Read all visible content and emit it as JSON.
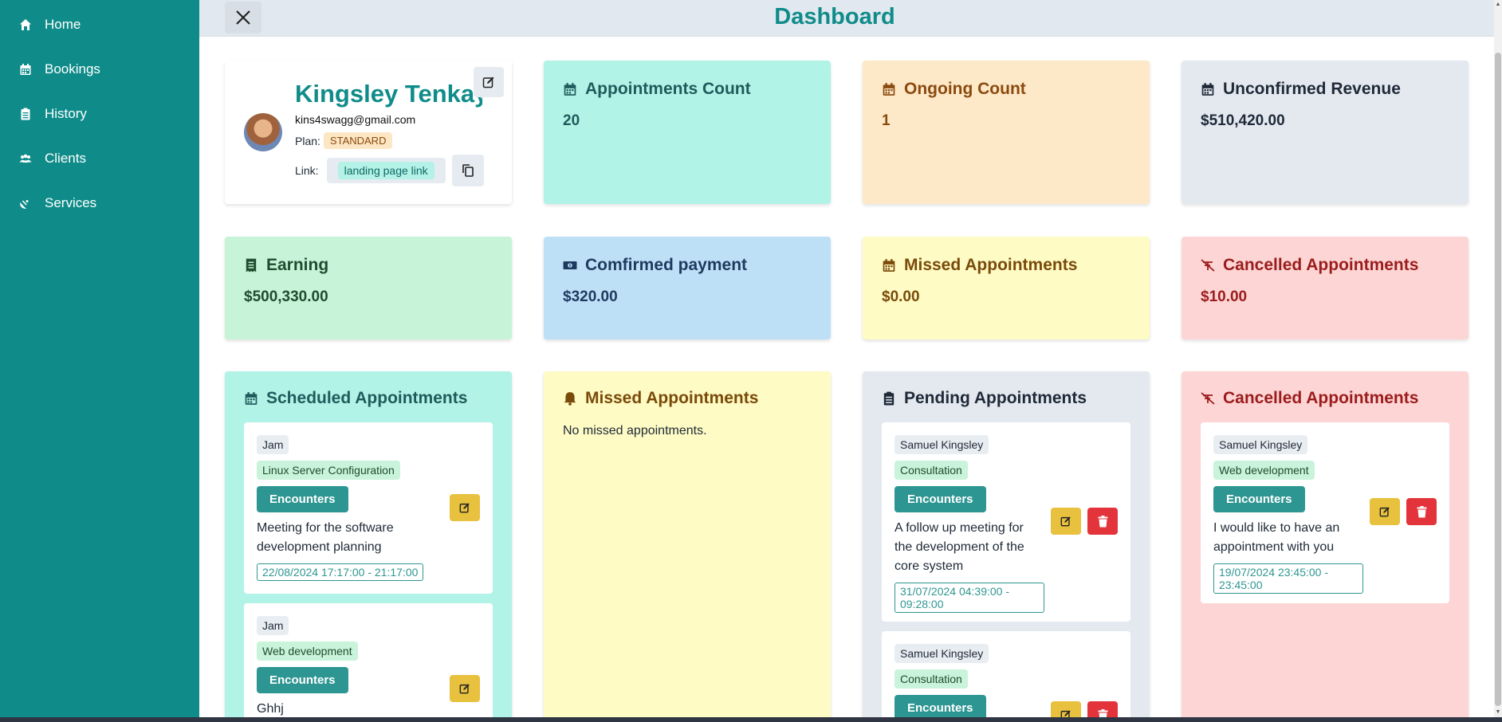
{
  "sidebar": {
    "items": [
      {
        "label": "Home",
        "icon": "home-icon"
      },
      {
        "label": "Bookings",
        "icon": "calendar-icon"
      },
      {
        "label": "History",
        "icon": "clipboard-icon"
      },
      {
        "label": "Clients",
        "icon": "users-icon"
      },
      {
        "label": "Services",
        "icon": "satellite-dish-icon"
      }
    ]
  },
  "header": {
    "title": "Dashboard"
  },
  "profile": {
    "name": "Kingsley Tenkay",
    "email": "kins4swagg@gmail.com",
    "plan_label": "Plan:",
    "plan": "STANDARD",
    "link_label": "Link:",
    "link_text": "landing page link"
  },
  "stats": {
    "appointments_count": {
      "title": "Appointments Count",
      "value": "20"
    },
    "ongoing_count": {
      "title": "Ongoing Count",
      "value": "1"
    },
    "unconfirmed_revenue": {
      "title": "Unconfirmed Revenue",
      "value": "$510,420.00"
    },
    "earning": {
      "title": "Earning",
      "value": "$500,330.00"
    },
    "confirmed_payment": {
      "title": "Comfirmed payment",
      "value": "$320.00"
    },
    "missed_appointments": {
      "title": "Missed Appointments",
      "value": "$0.00"
    },
    "cancelled_appointments": {
      "title": "Cancelled Appointments",
      "value": "$10.00"
    }
  },
  "columns": {
    "scheduled": {
      "title": "Scheduled Appointments",
      "items": [
        {
          "client": "Jam",
          "service": "Linux Server Configuration",
          "button": "Encounters",
          "description": "Meeting for the software development planning",
          "time": "22/08/2024 17:17:00 - 21:17:00"
        },
        {
          "client": "Jam",
          "service": "Web development",
          "button": "Encounters",
          "description": "Ghhj"
        }
      ]
    },
    "missed": {
      "title": "Missed Appointments",
      "empty": "No missed appointments."
    },
    "pending": {
      "title": "Pending Appointments",
      "items": [
        {
          "client": "Samuel Kingsley",
          "service": "Consultation",
          "button": "Encounters",
          "description": "A follow up meeting for the development of the core system",
          "time": "31/07/2024 04:39:00 - 09:28:00"
        },
        {
          "client": "Samuel Kingsley",
          "service": "Consultation",
          "button": "Encounters"
        }
      ]
    },
    "cancelled": {
      "title": "Cancelled Appointments",
      "items": [
        {
          "client": "Samuel Kingsley",
          "service": "Web development",
          "button": "Encounters",
          "description": "I would like to have an appointment with you",
          "time": "19/07/2024 23:45:00 - 23:45:00"
        }
      ]
    }
  },
  "colors": {
    "brand": "#0f8c89",
    "appointments_count_bg": "#b2f3e8",
    "ongoing_bg": "#fde8c8",
    "unconfirmed_bg": "#e4e9f0",
    "earning_bg": "#c7f3d8",
    "confirmed_bg": "#bde0f7",
    "missed_bg": "#fefbc4",
    "cancelled_bg": "#fdd5d5"
  }
}
